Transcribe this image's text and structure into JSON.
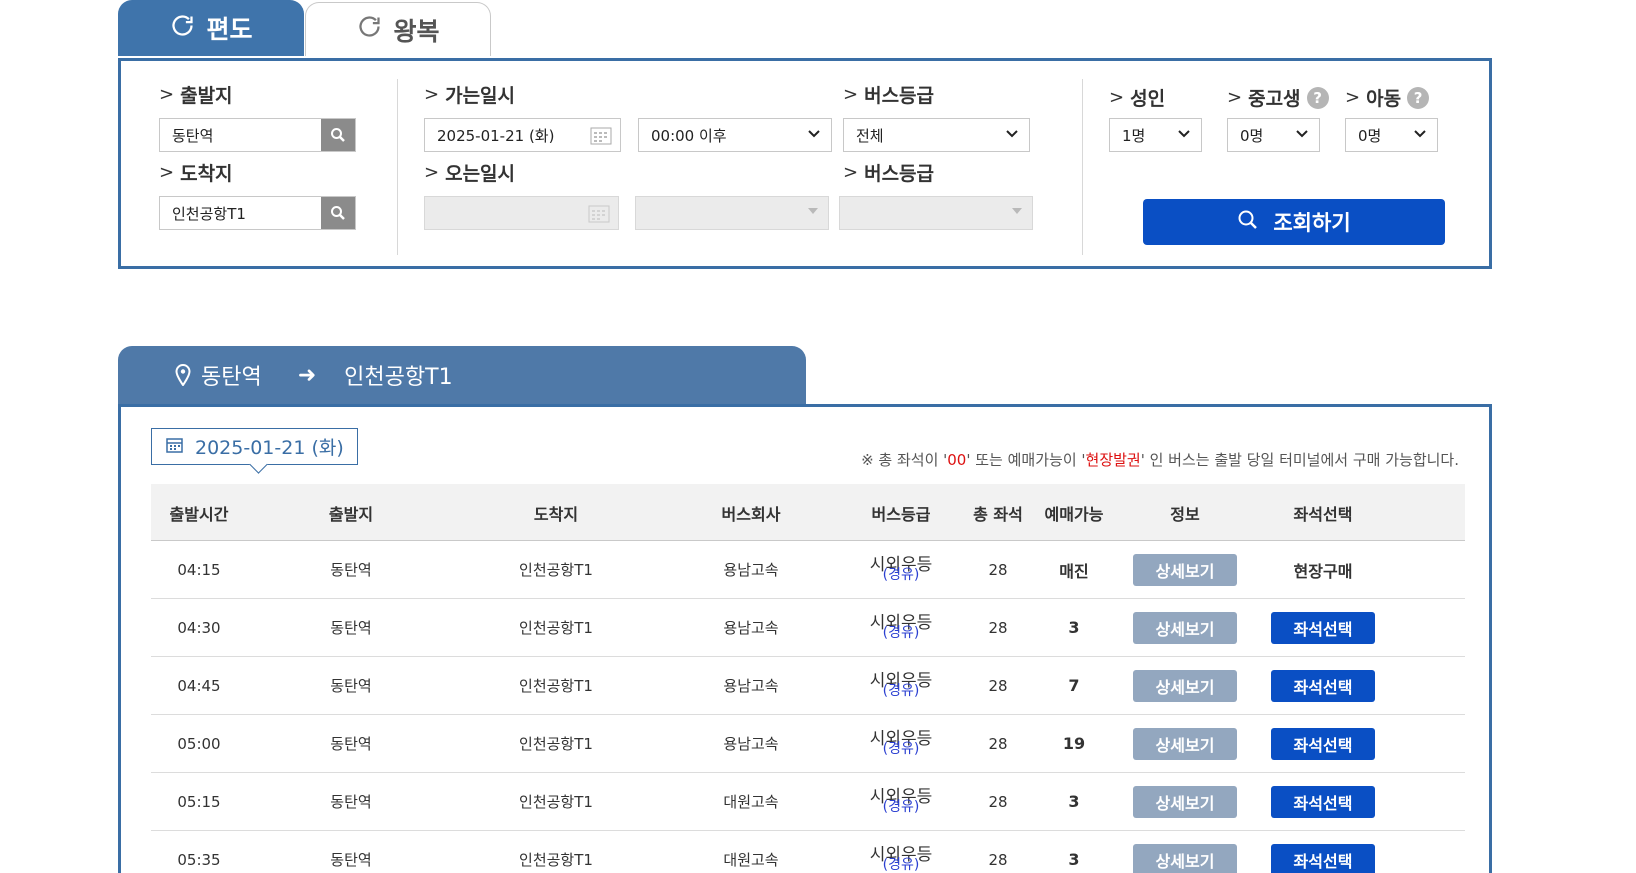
{
  "tabs": {
    "oneway": "편도",
    "round": "왕복"
  },
  "search": {
    "departure_label": "출발지",
    "departure_value": "동탄역",
    "arrival_label": "도착지",
    "arrival_value": "인천공항T1",
    "go_date_label": "가는일시",
    "go_date_value": "2025-01-21 (화)",
    "go_time_value": "00:00 이후",
    "bus_grade_label": "버스등급",
    "bus_grade_value": "전체",
    "return_date_label": "오는일시",
    "return_bus_grade_label": "버스등급",
    "adult_label": "성인",
    "adult_value": "1명",
    "youth_label": "중고생",
    "youth_value": "0명",
    "child_label": "아동",
    "child_value": "0명",
    "help_symbol": "?",
    "submit_label": "조회하기"
  },
  "route": {
    "from": "동탄역",
    "to": "인천공항T1",
    "arrow": "➜"
  },
  "results": {
    "date": "2025-01-21 (화)",
    "notice_pre": "※ 총 좌석이 '",
    "notice_red1": "00",
    "notice_mid": "' 또는 예매가능이 '",
    "notice_red2": "현장발권",
    "notice_post": "' 인 버스는 출발 당일 터미널에서 구매 가능합니다.",
    "columns": [
      "출발시간",
      "출발지",
      "도착지",
      "버스회사",
      "버스등급",
      "총 좌석",
      "예매가능",
      "정보",
      "좌석선택"
    ],
    "rows": [
      {
        "time": "04:15",
        "dep": "동탄역",
        "arr": "인천공항T1",
        "company": "용남고속",
        "grade": "시외우등",
        "grade_sub": "(경유)",
        "seats": "28",
        "avail": "매진",
        "info": "상세보기",
        "action": "현장구매"
      },
      {
        "time": "04:30",
        "dep": "동탄역",
        "arr": "인천공항T1",
        "company": "용남고속",
        "grade": "시외우등",
        "grade_sub": "(경유)",
        "seats": "28",
        "avail": "3",
        "info": "상세보기",
        "action": "좌석선택"
      },
      {
        "time": "04:45",
        "dep": "동탄역",
        "arr": "인천공항T1",
        "company": "용남고속",
        "grade": "시외우등",
        "grade_sub": "(경유)",
        "seats": "28",
        "avail": "7",
        "info": "상세보기",
        "action": "좌석선택"
      },
      {
        "time": "05:00",
        "dep": "동탄역",
        "arr": "인천공항T1",
        "company": "용남고속",
        "grade": "시외우등",
        "grade_sub": "(경유)",
        "seats": "28",
        "avail": "19",
        "info": "상세보기",
        "action": "좌석선택"
      },
      {
        "time": "05:15",
        "dep": "동탄역",
        "arr": "인천공항T1",
        "company": "대원고속",
        "grade": "시외우등",
        "grade_sub": "(경유)",
        "seats": "28",
        "avail": "3",
        "info": "상세보기",
        "action": "좌석선택"
      },
      {
        "time": "05:35",
        "dep": "동탄역",
        "arr": "인천공항T1",
        "company": "대원고속",
        "grade": "시외우등",
        "grade_sub": "(경유)",
        "seats": "28",
        "avail": "3",
        "info": "상세보기",
        "action": "좌석선택"
      }
    ]
  }
}
